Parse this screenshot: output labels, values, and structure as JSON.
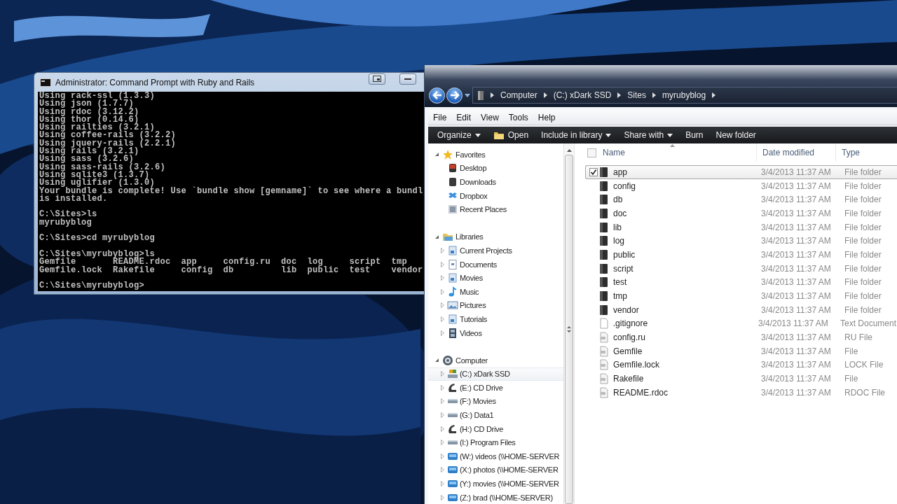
{
  "command_prompt": {
    "title": "Administrator: Command Prompt with Ruby and Rails",
    "blocks": [
      [
        "Using rack-ssl (1.3.3)",
        "Using json (1.7.7)",
        "Using rdoc (3.12.2)",
        "Using thor (0.14.6)",
        "Using railties (3.2.1)",
        "Using coffee-rails (3.2.2)",
        "Using jquery-rails (2.2.1)",
        "Using rails (3.2.1)",
        "Using sass (3.2.6)",
        "Using sass-rails (3.2.6)",
        "Using sqlite3 (1.3.7)",
        "Using uglifier (1.3.0)",
        "Your bundle is complete! Use `bundle show [gemname]` to see where a bundl",
        "is installed."
      ],
      [
        "C:\\Sites>ls",
        "myrubyblog"
      ],
      [
        "C:\\Sites>cd myrubyblog"
      ],
      [
        "C:\\Sites\\myrubyblog>ls",
        "Gemfile       README.rdoc  app     config.ru  doc  log     script  tmp",
        "Gemfile.lock  Rakefile     config  db         lib  public  test    vendor"
      ],
      [
        "C:\\Sites\\myrubyblog>"
      ]
    ]
  },
  "explorer": {
    "breadcrumb": [
      "Computer",
      "(C:) xDark SSD",
      "Sites",
      "myrubyblog"
    ],
    "menu": [
      "File",
      "Edit",
      "View",
      "Tools",
      "Help"
    ],
    "commands": [
      {
        "label": "Organize",
        "dropdown": true
      },
      {
        "label": "Open",
        "dropdown": false,
        "kind": "folder"
      },
      {
        "label": "Include in library",
        "dropdown": true
      },
      {
        "label": "Share with",
        "dropdown": true
      },
      {
        "label": "Burn",
        "dropdown": false
      },
      {
        "label": "New folder",
        "dropdown": false
      }
    ],
    "navigation": [
      {
        "label": "Favorites",
        "kind": "star",
        "expanded": true,
        "children": [
          {
            "label": "Desktop",
            "kind": "desktop"
          },
          {
            "label": "Downloads",
            "kind": "downloads"
          },
          {
            "label": "Dropbox",
            "kind": "dropbox"
          },
          {
            "label": "Recent Places",
            "kind": "recent"
          }
        ]
      },
      {
        "label": "Libraries",
        "kind": "libraries",
        "expanded": true,
        "children": [
          {
            "label": "Current Projects",
            "kind": "library",
            "expanded": false
          },
          {
            "label": "Documents",
            "kind": "document",
            "expanded": false
          },
          {
            "label": "Movies",
            "kind": "library",
            "expanded": false
          },
          {
            "label": "Music",
            "kind": "music",
            "expanded": false
          },
          {
            "label": "Pictures",
            "kind": "pictures",
            "expanded": false
          },
          {
            "label": "Tutorials",
            "kind": "library",
            "expanded": false
          },
          {
            "label": "Videos",
            "kind": "videos",
            "expanded": false
          }
        ]
      },
      {
        "label": "Computer",
        "kind": "computer",
        "expanded": true,
        "children": [
          {
            "label": "(C:) xDark SSD",
            "kind": "system",
            "expanded": false,
            "hovered": true
          },
          {
            "label": "(E:) CD Drive",
            "kind": "cd",
            "expanded": false
          },
          {
            "label": "(F:) Movies",
            "kind": "drive",
            "expanded": false
          },
          {
            "label": "(G:) Data1",
            "kind": "drive",
            "expanded": false
          },
          {
            "label": "(H:) CD Drive",
            "kind": "cd",
            "expanded": false
          },
          {
            "label": "(I:) Program Files",
            "kind": "drive",
            "expanded": false
          },
          {
            "label": "(W:) videos (\\\\HOME-SERVER",
            "kind": "network",
            "expanded": false
          },
          {
            "label": "(X:) photos (\\\\HOME-SERVER",
            "kind": "network",
            "expanded": false
          },
          {
            "label": "(Y:) movies (\\\\HOME-SERVER",
            "kind": "network",
            "expanded": false
          },
          {
            "label": "(Z:) brad (\\\\HOME-SERVER)",
            "kind": "network",
            "expanded": false
          }
        ]
      }
    ],
    "select_all": {
      "checked": false
    },
    "columns": [
      {
        "label": "Name",
        "sorted": true
      },
      {
        "label": "Date modified",
        "sorted": false
      },
      {
        "label": "Type",
        "sorted": false
      }
    ],
    "files": [
      {
        "name": "app",
        "date": "3/4/2013 11:37 AM",
        "type": "File folder",
        "kind": "folder",
        "checked": true,
        "selected": true
      },
      {
        "name": "config",
        "date": "3/4/2013 11:37 AM",
        "type": "File folder",
        "kind": "folder",
        "checked": false,
        "selected": false
      },
      {
        "name": "db",
        "date": "3/4/2013 11:37 AM",
        "type": "File folder",
        "kind": "folder",
        "checked": false,
        "selected": false
      },
      {
        "name": "doc",
        "date": "3/4/2013 11:37 AM",
        "type": "File folder",
        "kind": "folder",
        "checked": false,
        "selected": false
      },
      {
        "name": "lib",
        "date": "3/4/2013 11:37 AM",
        "type": "File folder",
        "kind": "folder",
        "checked": false,
        "selected": false
      },
      {
        "name": "log",
        "date": "3/4/2013 11:37 AM",
        "type": "File folder",
        "kind": "folder",
        "checked": false,
        "selected": false
      },
      {
        "name": "public",
        "date": "3/4/2013 11:37 AM",
        "type": "File folder",
        "kind": "folder",
        "checked": false,
        "selected": false
      },
      {
        "name": "script",
        "date": "3/4/2013 11:37 AM",
        "type": "File folder",
        "kind": "folder",
        "checked": false,
        "selected": false
      },
      {
        "name": "test",
        "date": "3/4/2013 11:37 AM",
        "type": "File folder",
        "kind": "folder",
        "checked": false,
        "selected": false
      },
      {
        "name": "tmp",
        "date": "3/4/2013 11:37 AM",
        "type": "File folder",
        "kind": "folder",
        "checked": false,
        "selected": false
      },
      {
        "name": "vendor",
        "date": "3/4/2013 11:37 AM",
        "type": "File folder",
        "kind": "folder",
        "checked": false,
        "selected": false
      },
      {
        "name": ".gitignore",
        "date": "3/4/2013 11:37 AM",
        "type": "Text Document",
        "kind": "text",
        "checked": false,
        "selected": false
      },
      {
        "name": "config.ru",
        "date": "3/4/2013 11:37 AM",
        "type": "RU File",
        "kind": "file",
        "checked": false,
        "selected": false
      },
      {
        "name": "Gemfile",
        "date": "3/4/2013 11:37 AM",
        "type": "File",
        "kind": "file",
        "checked": false,
        "selected": false
      },
      {
        "name": "Gemfile.lock",
        "date": "3/4/2013 11:37 AM",
        "type": "LOCK File",
        "kind": "file",
        "checked": false,
        "selected": false
      },
      {
        "name": "Rakefile",
        "date": "3/4/2013 11:37 AM",
        "type": "File",
        "kind": "file",
        "checked": false,
        "selected": false
      },
      {
        "name": "README.rdoc",
        "date": "3/4/2013 11:37 AM",
        "type": "RDOC File",
        "kind": "file",
        "checked": false,
        "selected": false
      }
    ]
  }
}
